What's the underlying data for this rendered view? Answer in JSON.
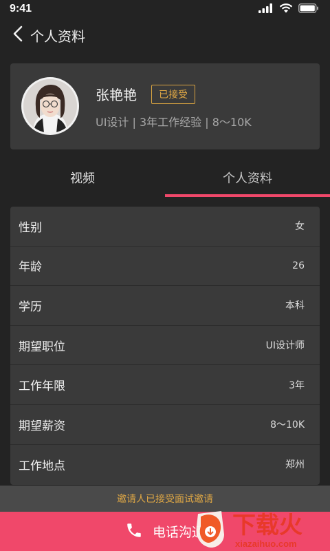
{
  "status_bar": {
    "time": "9:41",
    "icons": [
      "signal-icon",
      "wifi-icon",
      "battery-icon"
    ]
  },
  "nav": {
    "back_icon": "chevron-left-icon",
    "title": "个人资料"
  },
  "profile": {
    "name": "张艳艳",
    "status_tag": "已接受",
    "subtitle": "UI设计 | 3年工作经验 | 8～10K"
  },
  "tabs": [
    {
      "label": "视频",
      "active": false
    },
    {
      "label": "个人资料",
      "active": true
    }
  ],
  "info": [
    {
      "label": "性别",
      "value": "女"
    },
    {
      "label": "年龄",
      "value": "26"
    },
    {
      "label": "学历",
      "value": "本科"
    },
    {
      "label": "期望职位",
      "value": "UI设计师"
    },
    {
      "label": "工作年限",
      "value": "3年"
    },
    {
      "label": "期望薪资",
      "value": "8～10K"
    },
    {
      "label": "工作地点",
      "value": "郑州"
    }
  ],
  "footer": {
    "notice": "邀请人已接受面试邀请",
    "call_label": "电话沟通",
    "call_icon": "phone-icon"
  },
  "watermark": {
    "brand": "下载火",
    "domain": "xiazaihuo.com"
  },
  "colors": {
    "background": "#232323",
    "card": "#3a3a3a",
    "accent_pink": "#f0486a",
    "accent_gold": "#e0a845"
  }
}
